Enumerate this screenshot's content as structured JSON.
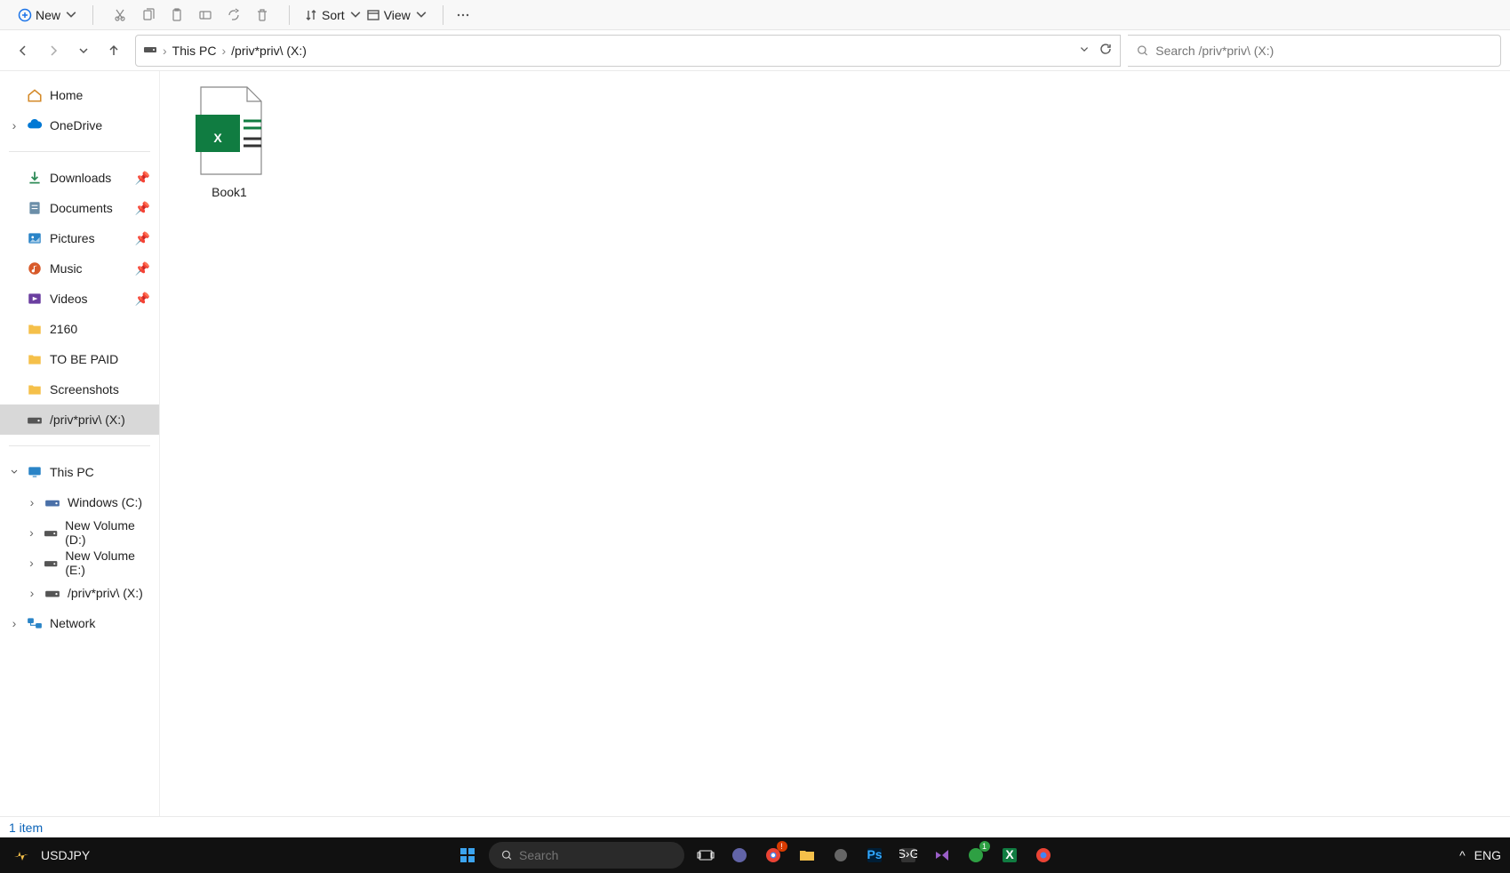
{
  "toolbar": {
    "new_label": "New",
    "sort_label": "Sort",
    "view_label": "View"
  },
  "breadcrumb": {
    "root": "This PC",
    "leaf": "/priv*priv\\ (X:)"
  },
  "search": {
    "placeholder": "Search /priv*priv\\ (X:)"
  },
  "sidebar": {
    "home": "Home",
    "onedrive": "OneDrive",
    "quick": [
      {
        "label": "Downloads",
        "pinned": true
      },
      {
        "label": "Documents",
        "pinned": true
      },
      {
        "label": "Pictures",
        "pinned": true
      },
      {
        "label": "Music",
        "pinned": true
      },
      {
        "label": "Videos",
        "pinned": true
      },
      {
        "label": "2160",
        "pinned": false
      },
      {
        "label": "TO BE PAID",
        "pinned": false
      },
      {
        "label": "Screenshots",
        "pinned": false
      },
      {
        "label": "/priv*priv\\ (X:)",
        "pinned": false,
        "active": true
      }
    ],
    "thispc": "This PC",
    "drives": [
      {
        "label": "Windows (C:)"
      },
      {
        "label": "New Volume (D:)"
      },
      {
        "label": "New Volume (E:)"
      },
      {
        "label": "/priv*priv\\ (X:)"
      }
    ],
    "network": "Network"
  },
  "content": {
    "files": [
      {
        "name": "Book1",
        "type": "excel"
      }
    ]
  },
  "status": {
    "text": "1 item"
  },
  "taskbar": {
    "widget": "USDJPY",
    "search_placeholder": "Search",
    "lang": "ENG"
  }
}
